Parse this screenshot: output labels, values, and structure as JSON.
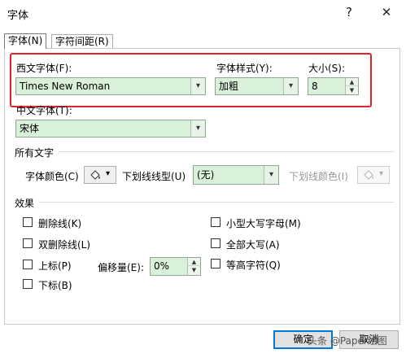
{
  "window": {
    "title": "字体",
    "help_label": "?",
    "close_label": "✕"
  },
  "tabs": [
    {
      "label": "字体(N)"
    },
    {
      "label": "字符间距(R)"
    }
  ],
  "western_font": {
    "label": "西文字体(F):",
    "value": "Times New Roman"
  },
  "font_style": {
    "label": "字体样式(Y):",
    "value": "加粗"
  },
  "font_size": {
    "label": "大小(S):",
    "value": "8"
  },
  "chinese_font": {
    "label": "中文字体(T):",
    "value": "宋体"
  },
  "all_text": {
    "heading": "所有文字",
    "font_color_label": "字体颜色(C)",
    "underline_type_label": "下划线线型(U)",
    "underline_type_value": "(无)",
    "underline_color_label": "下划线颜色(I)"
  },
  "effects": {
    "heading": "效果",
    "strikethrough": "删除线(K)",
    "double_strikethrough": "双删除线(L)",
    "superscript": "上标(P)",
    "subscript": "下标(B)",
    "offset_label": "偏移量(E):",
    "offset_value": "0%",
    "small_caps": "小型大写字母(M)",
    "all_caps": "全部大写(A)",
    "equal_height": "等高字符(Q)"
  },
  "buttons": {
    "ok": "确定",
    "cancel": "取消"
  },
  "watermark": "头条 @Paper绘图",
  "colors": {
    "highlight_border": "#e0242a",
    "field_bg": "#d9f0d9",
    "primary_border": "#0078d7"
  }
}
